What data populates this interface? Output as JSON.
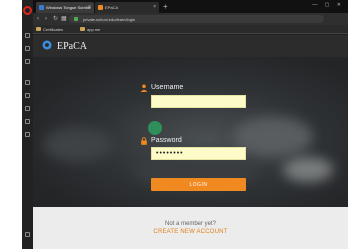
{
  "browser": {
    "tabs": [
      {
        "title": "Windows Tongue Subtitle",
        "active": true
      },
      {
        "title": "EPaCA",
        "active": false
      }
    ],
    "new_tab": "+",
    "window_controls": "— ▢ ✕",
    "url": "private.school.edu/learn/login"
  },
  "bookmarks": [
    {
      "label": "Certificates"
    },
    {
      "label": "app.me"
    }
  ],
  "app": {
    "logo_text": "EPaCA",
    "accent": "#f0891f"
  },
  "login": {
    "username_label": "Username",
    "username_value": "",
    "password_label": "Password",
    "password_value": "••••••••",
    "login_button": "LOGIN"
  },
  "footer": {
    "not_member": "Not a member yet?",
    "create_account": "CREATE NEW ACCOUNT"
  }
}
